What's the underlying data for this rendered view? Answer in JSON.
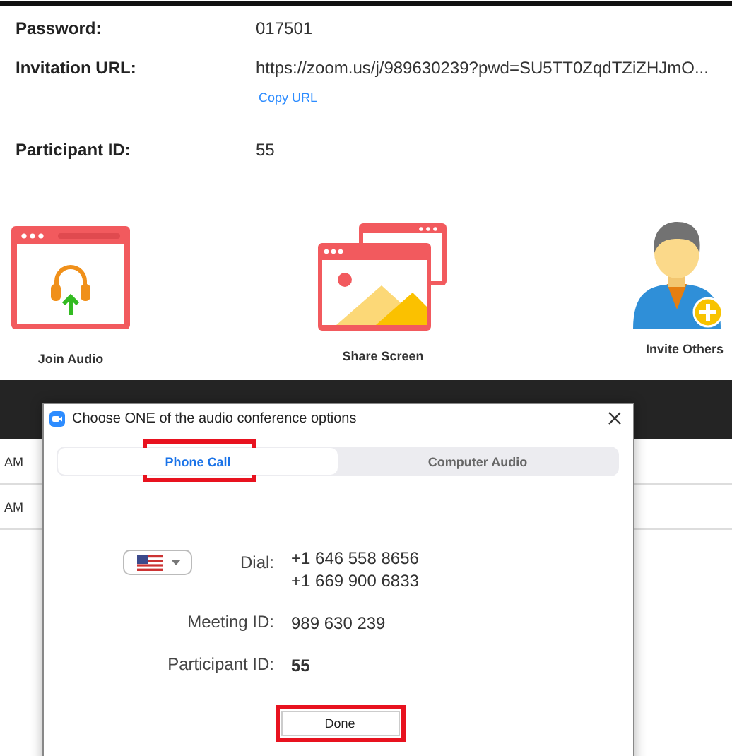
{
  "meeting_info": [
    {
      "label": "Password:",
      "value": "017501"
    },
    {
      "label": "Invitation URL:",
      "value": "https://zoom.us/j/989630239?pwd=SU5TT0ZqdTZiZHJmO...",
      "link": "Copy URL"
    },
    {
      "label": "Participant ID:",
      "value": "55"
    }
  ],
  "actions": [
    {
      "kind": "join-audio",
      "label": "Join Audio"
    },
    {
      "kind": "share-screen",
      "label": "Share Screen"
    },
    {
      "kind": "invite",
      "label": "Invite Others"
    }
  ],
  "background_rows": [
    {
      "time": "AM"
    },
    {
      "time": "AM"
    }
  ],
  "dialog": {
    "title": "Choose ONE of the audio conference options",
    "tabs": [
      {
        "label": "Phone Call",
        "selected": true,
        "highlighted": true
      },
      {
        "label": "Computer Audio",
        "selected": false,
        "highlighted": false
      }
    ],
    "dial_label": "Dial:",
    "numbers": [
      "+1 646 558 8656",
      "+1 669 900 6833"
    ],
    "details": [
      {
        "label": "Meeting ID:",
        "value": "989 630 239",
        "bold": false
      },
      {
        "label": "Participant ID:",
        "value": "55",
        "bold": true
      }
    ],
    "done": {
      "label": "Done",
      "highlighted": true
    }
  }
}
